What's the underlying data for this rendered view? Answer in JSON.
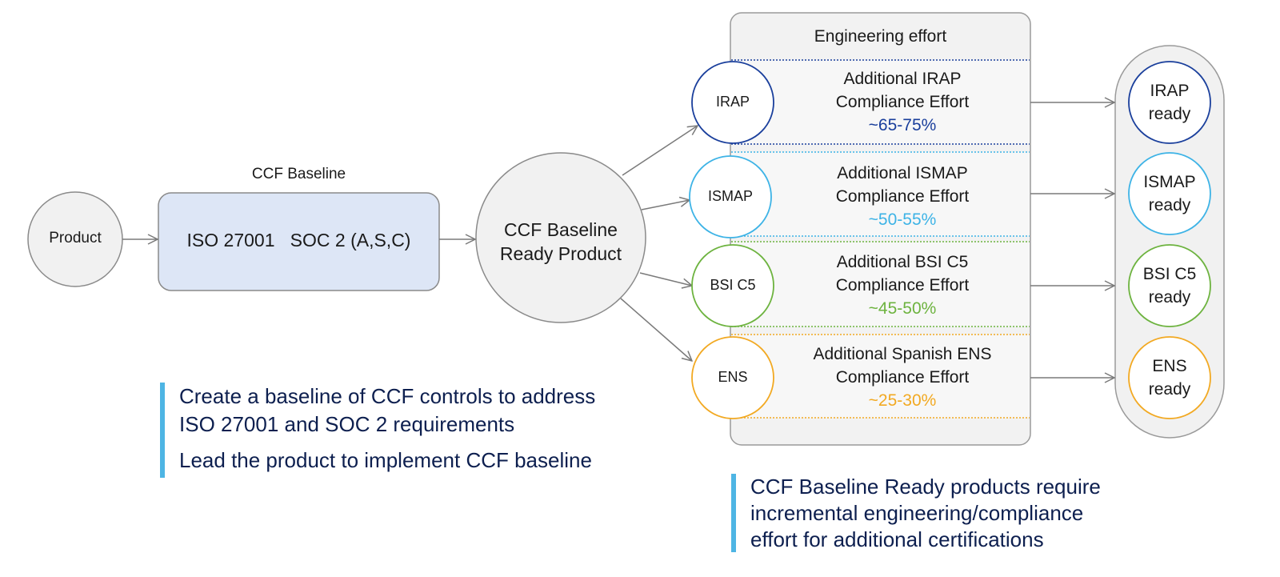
{
  "start_node": {
    "label": "Product"
  },
  "baseline": {
    "caption": "CCF Baseline",
    "standards_text": "ISO 27001   SOC 2 (A,S,C)"
  },
  "ready_product": {
    "line1": "CCF Baseline",
    "line2": "Ready Product"
  },
  "effort_panel": {
    "title": "Engineering effort",
    "rows": [
      {
        "cert": "IRAP",
        "line1": "Additional IRAP",
        "line2": "Compliance Effort",
        "effort": "~65-75%",
        "effort_range_pct": [
          65,
          75
        ],
        "color": "#1a3f9c",
        "ready_line1": "IRAP",
        "ready_line2": "ready"
      },
      {
        "cert": "ISMAP",
        "line1": "Additional ISMAP",
        "line2": "Compliance Effort",
        "effort": "~50-55%",
        "effort_range_pct": [
          50,
          55
        ],
        "color": "#3db3e6",
        "ready_line1": "ISMAP",
        "ready_line2": "ready"
      },
      {
        "cert": "BSI C5",
        "line1": "Additional BSI C5",
        "line2": "Compliance Effort",
        "effort": "~45-50%",
        "effort_range_pct": [
          45,
          50
        ],
        "color": "#6db33f",
        "ready_line1": "BSI C5",
        "ready_line2": "ready"
      },
      {
        "cert": "ENS",
        "line1": "Additional Spanish ENS",
        "line2": "Compliance Effort",
        "effort": "~25-30%",
        "effort_range_pct": [
          25,
          30
        ],
        "color": "#f2a922",
        "ready_line1": "ENS",
        "ready_line2": "ready"
      }
    ]
  },
  "notes_left": [
    "Create a baseline of CCF controls to address",
    "ISO 27001 and SOC 2 requirements",
    "Lead the product to implement CCF baseline"
  ],
  "notes_right": [
    "CCF Baseline Ready products require",
    "incremental engineering/compliance",
    "effort for additional certifications"
  ],
  "colors": {
    "accent_bar": "#4eb5e4",
    "note_text": "#0d1f4f",
    "baseline_fill": "#dde6f6",
    "node_fill": "#f1f1f1",
    "stroke": "#8a8a8a"
  }
}
